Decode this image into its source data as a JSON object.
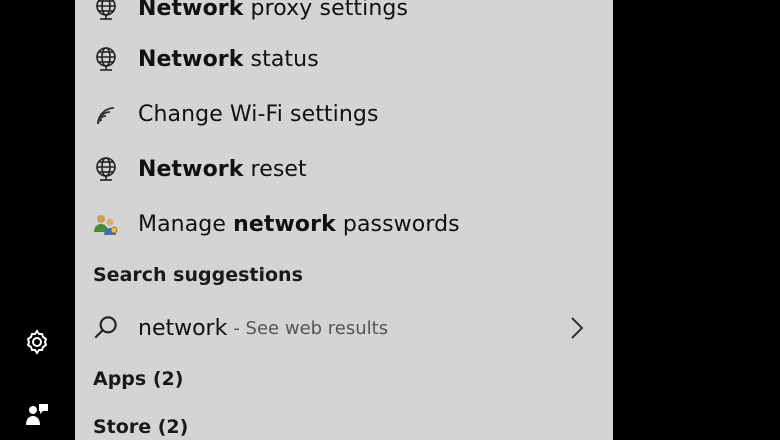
{
  "results": [
    {
      "id": "network-proxy",
      "icon": "globe-monitor-icon",
      "bold": "Network",
      "rest": " proxy settings"
    },
    {
      "id": "network-status",
      "icon": "globe-monitor-icon",
      "bold": "Network",
      "rest": " status"
    },
    {
      "id": "wifi-settings",
      "icon": "wifi-icon",
      "bold": "",
      "rest": "Change Wi-Fi settings"
    },
    {
      "id": "network-reset",
      "icon": "globe-monitor-icon",
      "bold": "Network",
      "rest": " reset"
    },
    {
      "id": "manage-passwords",
      "icon": "users-key-icon",
      "pre": "Manage ",
      "bold": "network",
      "rest": " passwords"
    }
  ],
  "search_suggestions": {
    "header": "Search suggestions",
    "query": "network",
    "hint": "- See web results"
  },
  "apps_header": "Apps (2)",
  "store_header": "Store (2)",
  "left_rail": {
    "icons": [
      "gear-icon",
      "user-feedback-icon"
    ]
  },
  "colors": {
    "panel_bg": "#d4d4d4",
    "rail_bg": "#000000",
    "text": "#111111"
  }
}
